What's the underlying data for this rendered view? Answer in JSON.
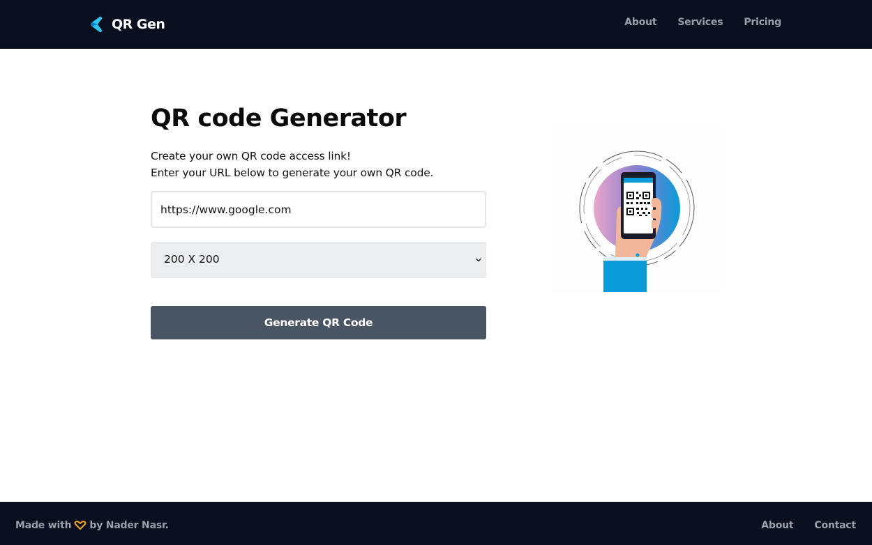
{
  "header": {
    "brand_name": "QR Gen",
    "nav": [
      "About",
      "Services",
      "Pricing"
    ]
  },
  "main": {
    "title": "QR code Generator",
    "description_line1": "Create your own QR code access link!",
    "description_line2": "Enter your URL below to generate your own QR code.",
    "url_input_value": "https://www.google.com",
    "size_select_value": "200 X 200",
    "generate_button_label": "Generate QR Code",
    "illustration_icon": "hand-holding-phone-with-qr-code-icon"
  },
  "footer": {
    "credit_prefix": "Made with",
    "credit_icon": "heart-icon",
    "credit_suffix": "by Nader Nasr.",
    "nav": [
      "About",
      "Contact"
    ]
  },
  "colors": {
    "header_bg": "#0a0f1f",
    "nav_text": "#9aa0aa",
    "button_bg": "#4a5563",
    "select_bg": "#edeef1",
    "accent": "#0a9ad8",
    "heart": "#f4a623"
  }
}
